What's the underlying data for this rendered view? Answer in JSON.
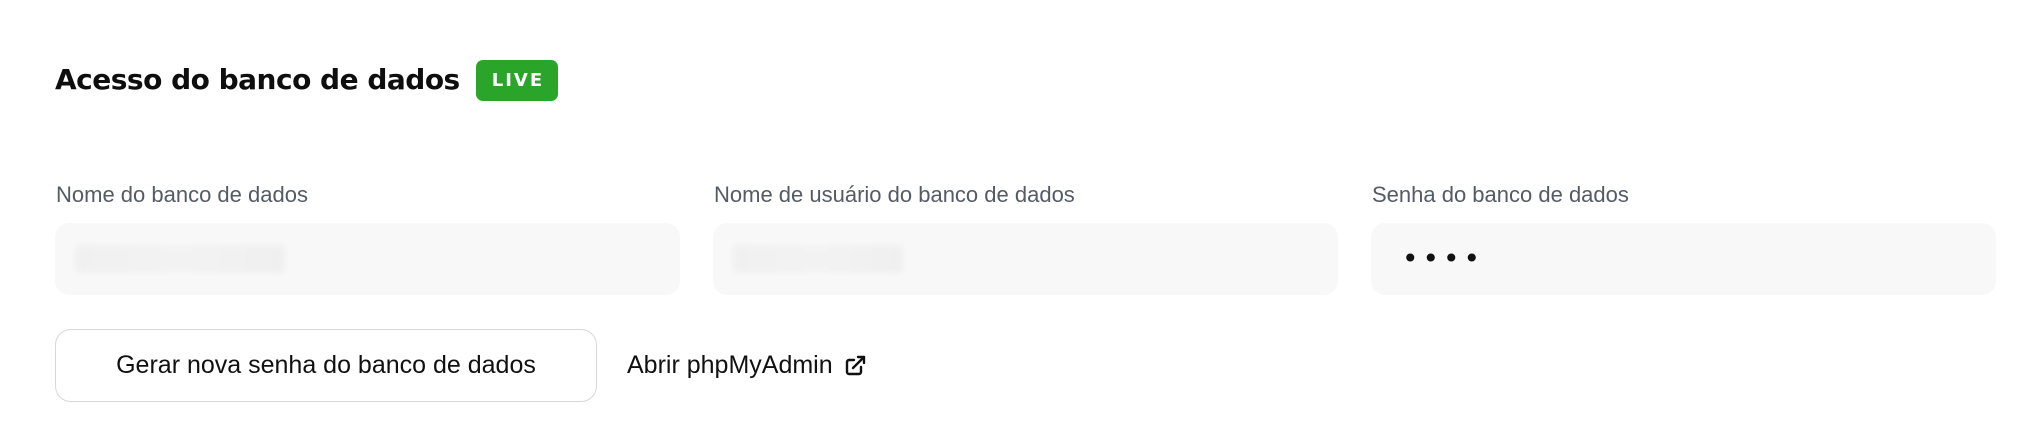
{
  "section": {
    "title": "Acesso do banco de dados",
    "badge": "LIVE",
    "badge_color": "#2aa52a"
  },
  "fields": [
    {
      "label": "Nome do banco de dados",
      "value": "",
      "value_hidden": true
    },
    {
      "label": "Nome de usuário do banco de dados",
      "value": "",
      "value_hidden": true
    },
    {
      "label": "Senha do banco de dados",
      "value": "••••",
      "value_hidden": false
    }
  ],
  "actions": {
    "generate_password_label": "Gerar nova senha do banco de dados",
    "open_phpmyadmin_label": "Abrir phpMyAdmin",
    "open_phpmyadmin_icon": "external-link-icon"
  }
}
